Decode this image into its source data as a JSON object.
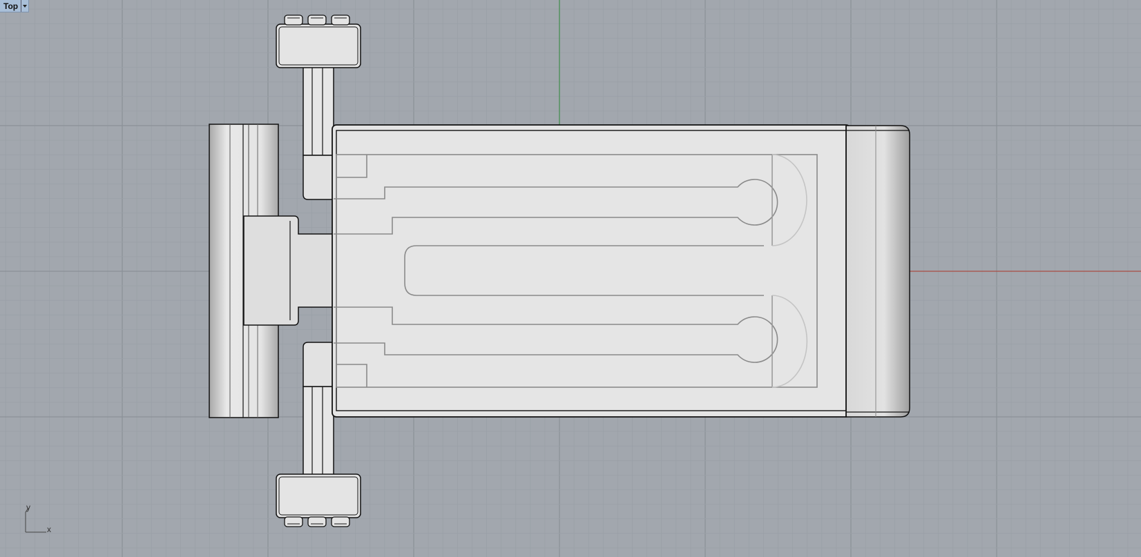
{
  "viewport": {
    "name": "Top",
    "menu_icon": "dropdown-arrow-icon",
    "background_color": "#a2a7ae",
    "grid_minor_color": "#9aa0a7",
    "grid_major_color": "#8b9198",
    "x_axis_color": "#b03a2e",
    "y_axis_color": "#2e8b3a"
  },
  "axis_widget": {
    "x_label": "x",
    "y_label": "y"
  },
  "model": {
    "object_fill": "#e4e4e4",
    "edge_color": "#111111",
    "curve_color": "#8a8a8a"
  }
}
